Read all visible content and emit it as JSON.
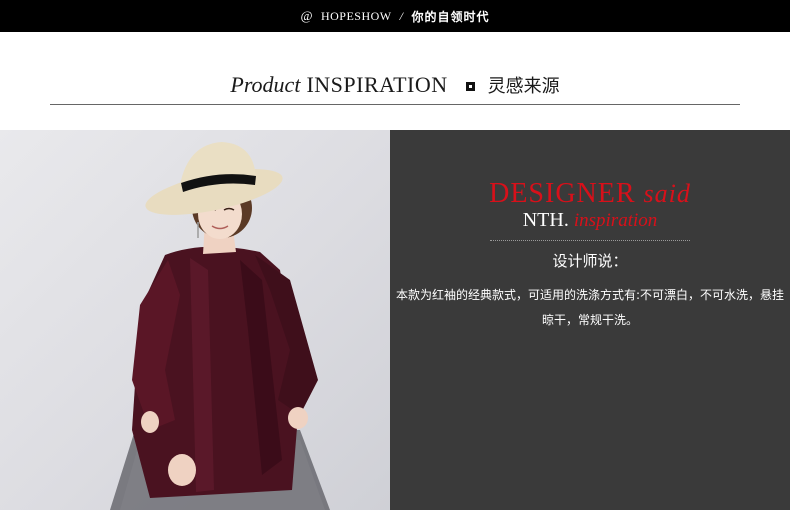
{
  "topbar": {
    "at_symbol": "@",
    "brand": "HOPESHOW",
    "separator": "/",
    "slogan": "你的自领时代"
  },
  "heading": {
    "italic_word": "Product",
    "caps_word": "INSPIRATION",
    "chinese": "灵感来源"
  },
  "photo": {
    "description_icon": "model-photo"
  },
  "panel": {
    "designer_word": "DESIGNER",
    "said_word": "said",
    "nth_word": "NTH.",
    "inspiration_word": "inspiration",
    "label": "设计师说：",
    "description_line1": "本款为红袖的经典款式，可适用的洗涤方式有:不可漂白，不可水洗，悬挂",
    "description_line2": "晾干，常规干洗。"
  },
  "colors": {
    "accent_red": "#d8101a",
    "panel_bg": "#3a3a3a",
    "coat": "#4a1220",
    "hat": "#e8dcc0"
  }
}
